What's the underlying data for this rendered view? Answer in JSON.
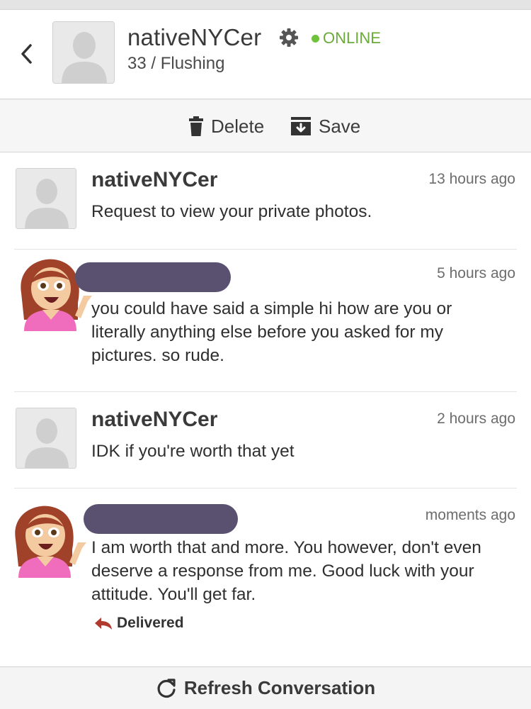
{
  "header": {
    "username": "nativeNYCer",
    "status": "ONLINE",
    "subtitle": "33 / Flushing",
    "icons": {
      "back": "chevron-left-icon",
      "settings": "gear-icon"
    },
    "colors": {
      "online": "#6aab3a"
    }
  },
  "actions": {
    "delete_label": "Delete",
    "save_label": "Save"
  },
  "messages": [
    {
      "sender": "nativeNYCer",
      "time": "13 hours ago",
      "text": "Request to view your private photos."
    },
    {
      "sender": "",
      "time": "5 hours ago",
      "text": "you could have said a simple hi how are you or literally anything else before you asked for my pictures. so rude."
    },
    {
      "sender": "nativeNYCer",
      "time": "2 hours ago",
      "text": "IDK if you're worth that yet"
    },
    {
      "sender": "",
      "time": "moments ago",
      "text": "I am worth that and more. You however, don't even deserve a response from me. Good luck with your attitude. You'll get far."
    }
  ],
  "delivery": {
    "status": "Delivered"
  },
  "footer": {
    "refresh_label": "Refresh Conversation"
  }
}
